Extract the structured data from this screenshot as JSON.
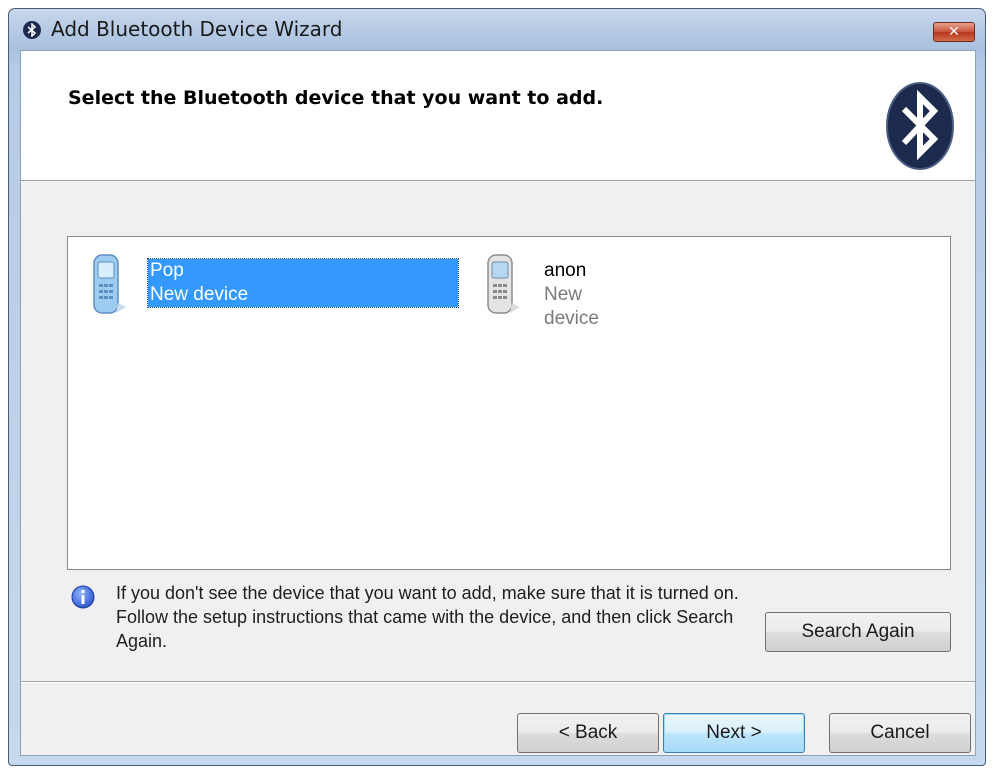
{
  "window": {
    "title": "Add Bluetooth Device Wizard",
    "close_label": "✕"
  },
  "header": {
    "title": "Select the Bluetooth device that you want to add."
  },
  "devices": [
    {
      "name": "Pop",
      "status": "New device",
      "selected": true
    },
    {
      "name": "anon",
      "status": "New device",
      "selected": false
    }
  ],
  "info": {
    "text": "If you don't see the device that you want to add, make sure that it is turned on. Follow the setup instructions that came with the device, and then click Search Again."
  },
  "buttons": {
    "search_again": "Search Again",
    "back": "< Back",
    "next": "Next >",
    "cancel": "Cancel"
  },
  "colors": {
    "selection": "#3399ff",
    "bluetooth_logo": "#1c2b4d"
  }
}
